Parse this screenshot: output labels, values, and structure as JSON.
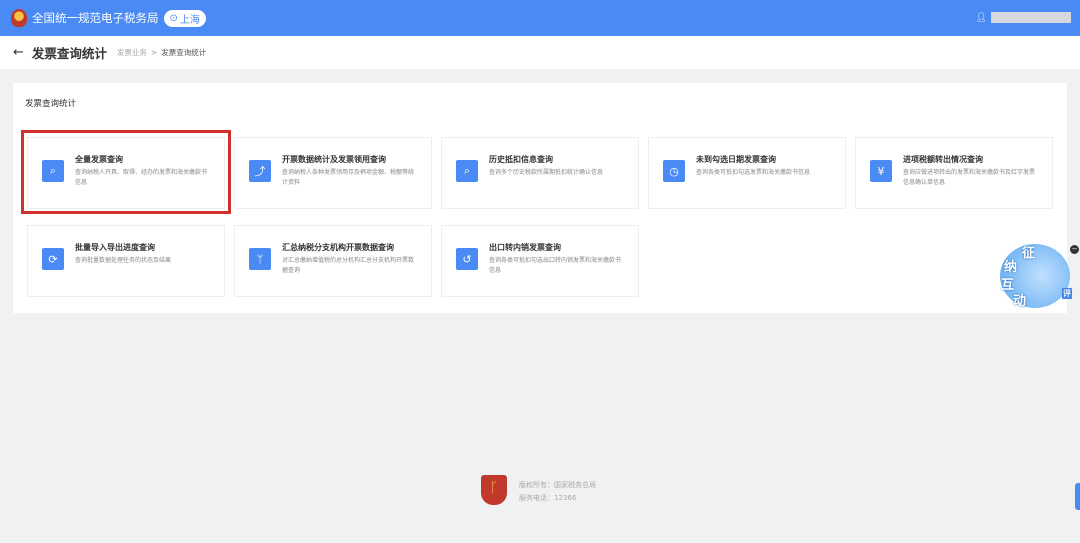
{
  "header": {
    "app_title": "全国统一规范电子税务局",
    "region": "上海"
  },
  "breadcrumb": {
    "back": "←",
    "title": "发票查询统计",
    "items": [
      "发票业务",
      "发票查询统计"
    ],
    "sep": ">"
  },
  "panel": {
    "title": "发票查询统计"
  },
  "cards": [
    {
      "title": "全量发票查询",
      "desc": "查询纳税人开具、取得、经办的发票和海关缴款书信息",
      "icon": "⌕"
    },
    {
      "title": "开票数据统计及发票领用查询",
      "desc": "查询纳税人各种发票领用存及柄项金额、税额等统计资料",
      "icon": "⤴"
    },
    {
      "title": "历史抵扣信息查询",
      "desc": "查询多个历史税款所属期抵扣统计确认信息",
      "icon": "⌕"
    },
    {
      "title": "未到勾选日期发票查询",
      "desc": "查询各类可抵扣勾选发票和海关缴款书信息",
      "icon": "◷"
    },
    {
      "title": "进项税额转出情况查询",
      "desc": "查询应做进项转出的发票和海关缴款书及红字发票信息确认单信息",
      "icon": "¥"
    },
    {
      "title": "批量导入导出进度查询",
      "desc": "查询批量数据处理任务的状态及结果",
      "icon": "⟳"
    },
    {
      "title": "汇总纳税分支机构开票数据查询",
      "desc": "对汇总缴纳增值税的总分机构汇总分支机构开票数据查询",
      "icon": "ᛘ"
    },
    {
      "title": "出口转内销发票查询",
      "desc": "查询各类可抵扣勾选出口转内销发票和海关缴款书信息",
      "icon": "↺"
    }
  ],
  "assistant": {
    "chars": [
      "征",
      "纳",
      "互",
      "动"
    ],
    "badge": "评",
    "close": "−"
  },
  "footer": {
    "copyright": "版权所有：国家税务总局",
    "phone": "服务电话：12366"
  }
}
